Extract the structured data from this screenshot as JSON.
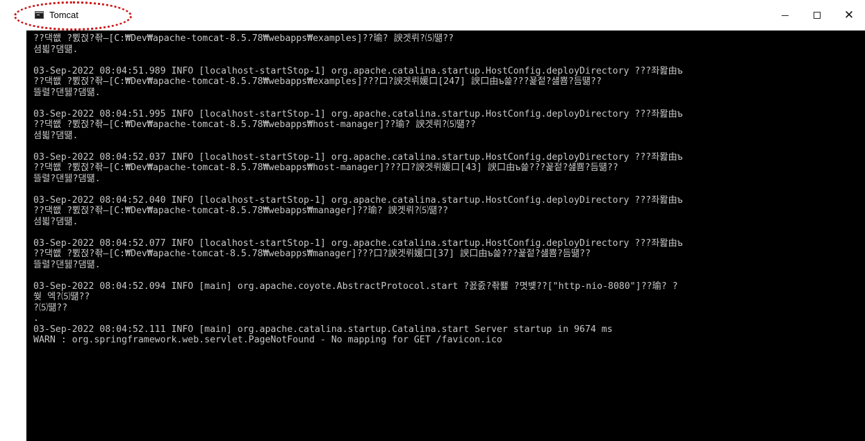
{
  "window": {
    "title": "Tomcat",
    "controls": {
      "minimize": "—",
      "maximize": "☐",
      "close": "✕"
    }
  },
  "console": {
    "lines": [
      "??댁쐢 ?쀬젅?좎—[C:₩Dev₩apache-tomcat-8.5.78₩webapps₩examples]??瑜? 諛겟뤼?⑸떎??",
      "셤븳?댐떎.",
      "",
      "03-Sep-2022 08:04:51.989 INFO [localhost-startStop-1] org.apache.catalina.startup.HostConfig.deployDirectory ???좌뫒由ъ",
      "??댁쐢 ?쀬젅?좎—[C:₩Dev₩apache-tomcat-8.5.78₩webapps₩examples]???口?諛겟뤼媛口[247] 諛口由ъ쓽???꾩젙?섎뿀?듬떎??",
      "뜰렬?댄뒗?댐떎.",
      "",
      "03-Sep-2022 08:04:51.995 INFO [localhost-startStop-1] org.apache.catalina.startup.HostConfig.deployDirectory ???좌뫒由ъ",
      "??댁쐢 ?쀬젅?좎—[C:₩Dev₩apache-tomcat-8.5.78₩webapps₩host-manager]??瑜? 諛겟뤼?⑸떎??",
      "셤븳?댐떎.",
      "",
      "03-Sep-2022 08:04:52.037 INFO [localhost-startStop-1] org.apache.catalina.startup.HostConfig.deployDirectory ???좌뫒由ъ",
      "??댁쐢 ?쀬젅?좎—[C:₩Dev₩apache-tomcat-8.5.78₩webapps₩host-manager]???口?諛겟뤼媛口[43] 諛口由ъ쓽???꾩젙?섎뿀?듬떎??",
      "뜰렬?댄뒗?댐떎.",
      "",
      "03-Sep-2022 08:04:52.040 INFO [localhost-startStop-1] org.apache.catalina.startup.HostConfig.deployDirectory ???좌뫒由ъ",
      "??댁쐢 ?쀬젅?좎—[C:₩Dev₩apache-tomcat-8.5.78₩webapps₩manager]??瑜? 諛겟뤼?⑸떎??",
      "셤븳?댐떎.",
      "",
      "03-Sep-2022 08:04:52.077 INFO [localhost-startStop-1] org.apache.catalina.startup.HostConfig.deployDirectory ???좌뫒由ъ",
      "??댁쐢 ?쀬젅?좎—[C:₩Dev₩apache-tomcat-8.5.78₩webapps₩manager]???口?諛겟뤼媛口[37] 諛口由ъ쓽???꾩젙?섎뿀?듬떎??",
      "뜰렬?댄뒗?댐떎.",
      "",
      "03-Sep-2022 08:04:52.094 INFO [main] org.apache.coyote.AbstractProtocol.start ?꾨줈?좎퐳 ?몃뱾??[\"http-nio-8080\"]??瑜? ?",
      "쒖 엑?⑸떎??",
      "?⑸떎??",
      ".",
      "03-Sep-2022 08:04:52.111 INFO [main] org.apache.catalina.startup.Catalina.start Server startup in 9674 ms",
      "WARN : org.springframework.web.servlet.PageNotFound - No mapping for GET /favicon.ico"
    ]
  }
}
